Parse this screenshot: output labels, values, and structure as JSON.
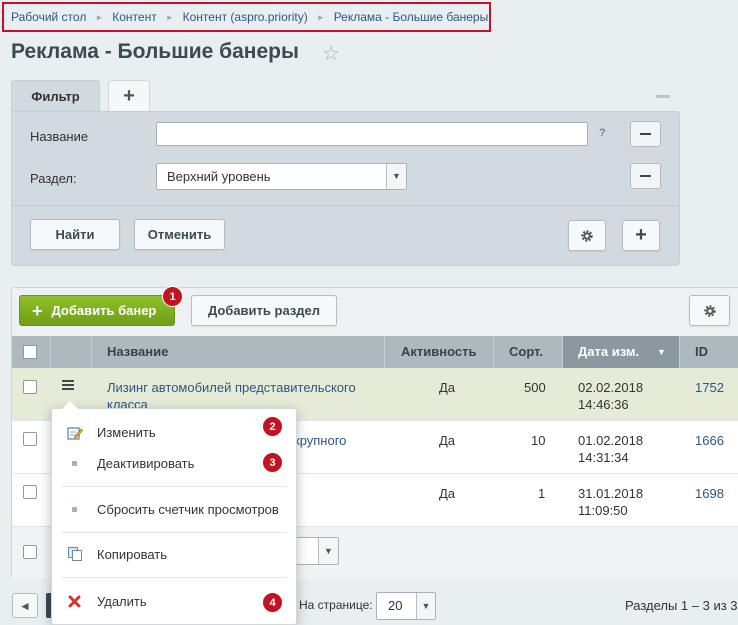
{
  "breadcrumbs": [
    "Рабочий стол",
    "Контент",
    "Контент (aspro.priority)",
    "Реклама - Большие банеры"
  ],
  "page_title": "Реклама - Большие банеры",
  "filter": {
    "tab_label": "Фильтр",
    "name_label": "Название",
    "name_value": "",
    "help": "?",
    "section_label": "Раздел:",
    "section_value": "Верхний уровень",
    "find_label": "Найти",
    "cancel_label": "Отменить"
  },
  "toolbar": {
    "add_banner_label": "Добавить банер",
    "add_section_label": "Добавить раздел"
  },
  "badges": [
    "1",
    "2",
    "3",
    "4"
  ],
  "table": {
    "columns": [
      "Название",
      "Активность",
      "Сорт.",
      "Дата изм.",
      "ID"
    ],
    "rows": [
      {
        "name_line1": "Лизинг автомобилей представительского",
        "name_line2": "класса",
        "active": "Да",
        "sort": "500",
        "date": "02.02.2018",
        "time": "14:46:36",
        "id": "1752"
      },
      {
        "name_partial": "крупного",
        "active": "Да",
        "sort": "10",
        "date": "01.02.2018",
        "time": "14:31:34",
        "id": "1666"
      },
      {
        "active": "Да",
        "sort": "1",
        "date": "31.01.2018",
        "time": "11:09:50",
        "id": "1698"
      }
    ]
  },
  "context_menu": {
    "items": [
      "Изменить",
      "Деактивировать",
      "Сбросить счетчик просмотров",
      "Копировать",
      "Удалить"
    ]
  },
  "pagination": {
    "per_page_label": "На странице:",
    "per_page_value": "20",
    "sections_count": "Разделы 1 – 3 из 3"
  },
  "colors": {
    "accent_green": "#7cb11f",
    "badge_red": "#c21322",
    "highlight_border": "#c8102e",
    "link": "#2d5886"
  },
  "icons": [
    "star-icon",
    "plus-icon",
    "minus-icon",
    "gear-icon",
    "hamburger-icon",
    "edit-icon",
    "copy-icon",
    "delete-icon",
    "chevron-down-icon",
    "chevron-left-icon"
  ]
}
